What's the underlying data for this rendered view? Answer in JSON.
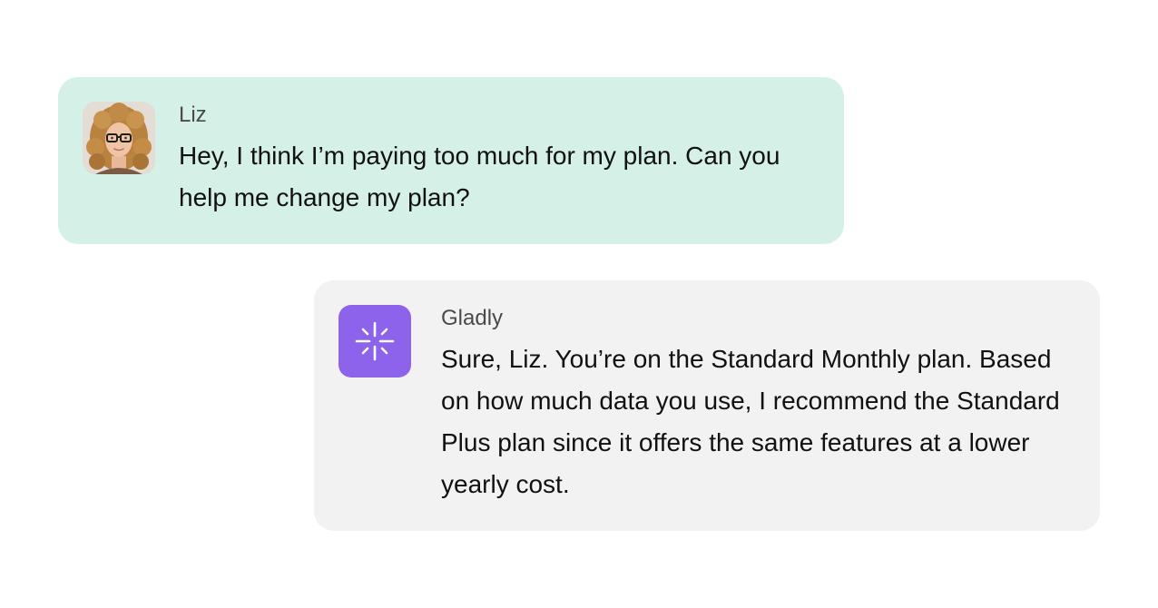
{
  "conversation": {
    "messages": [
      {
        "sender": "Liz",
        "avatar": "user-photo-avatar",
        "text": "Hey, I think I’m paying too much for my plan. Can you help me change my plan?",
        "bubble_color": "#d5f0e6"
      },
      {
        "sender": "Gladly",
        "avatar": "gladly-sparkle-icon",
        "text": "Sure, Liz. You’re on the Standard Monthly plan. Based on how much data you use, I recommend the Standard Plus plan since it offers the same features at a lower yearly cost.",
        "bubble_color": "#f2f2f2",
        "avatar_color": "#8c63ea"
      }
    ]
  }
}
